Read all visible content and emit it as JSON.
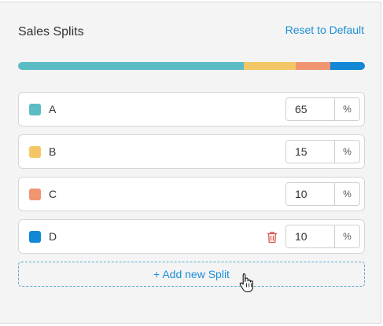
{
  "header": {
    "title": "Sales Splits",
    "reset_label": "Reset to Default"
  },
  "colors": {
    "A": "#5bbcc4",
    "B": "#f3c766",
    "C": "#f19470",
    "D": "#1187d6",
    "link": "#1b8fd8",
    "delete": "#d9534f"
  },
  "splits": [
    {
      "label": "A",
      "value": "65",
      "unit": "%",
      "color": "#5bbcc4",
      "deletable": false
    },
    {
      "label": "B",
      "value": "15",
      "unit": "%",
      "color": "#f3c766",
      "deletable": false
    },
    {
      "label": "C",
      "value": "10",
      "unit": "%",
      "color": "#f19470",
      "deletable": false
    },
    {
      "label": "D",
      "value": "10",
      "unit": "%",
      "color": "#1187d6",
      "deletable": true
    }
  ],
  "distribution_bar": {
    "fractions": [
      0.65,
      0.15,
      0.1,
      0.1
    ]
  },
  "icons": {
    "delete": "trash-icon",
    "cursor": "hand-pointer-icon"
  },
  "add_button": {
    "label": "+ Add new Split"
  }
}
